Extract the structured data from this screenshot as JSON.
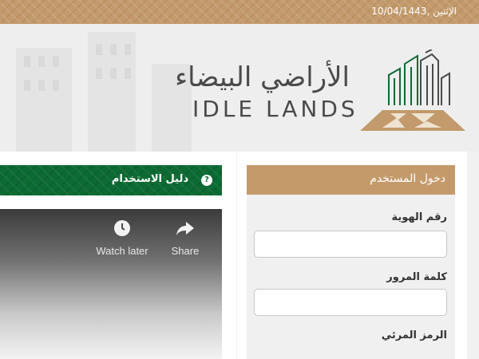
{
  "topbar": {
    "date": "الإثنين ,10/04/1443"
  },
  "logo": {
    "arabic": "الأراضي البيضاء",
    "english": "IDLE LANDS"
  },
  "guide": {
    "title": "دليل الاستخدام",
    "help_icon": "question-circle-icon"
  },
  "video": {
    "watch_later_label": "Watch later",
    "share_label": "Share",
    "watch_later_icon": "clock-icon",
    "share_icon": "share-arrow-icon"
  },
  "login": {
    "title": "دخول المستخدم",
    "id_label": "رقم الهوية",
    "id_value": "",
    "password_label": "كلمة المرور",
    "password_value": "",
    "captcha_label": "الرمز المرئي"
  },
  "colors": {
    "gold": "#c29a6b",
    "green": "#0c6a32",
    "text_dark": "#4a4a4a"
  }
}
